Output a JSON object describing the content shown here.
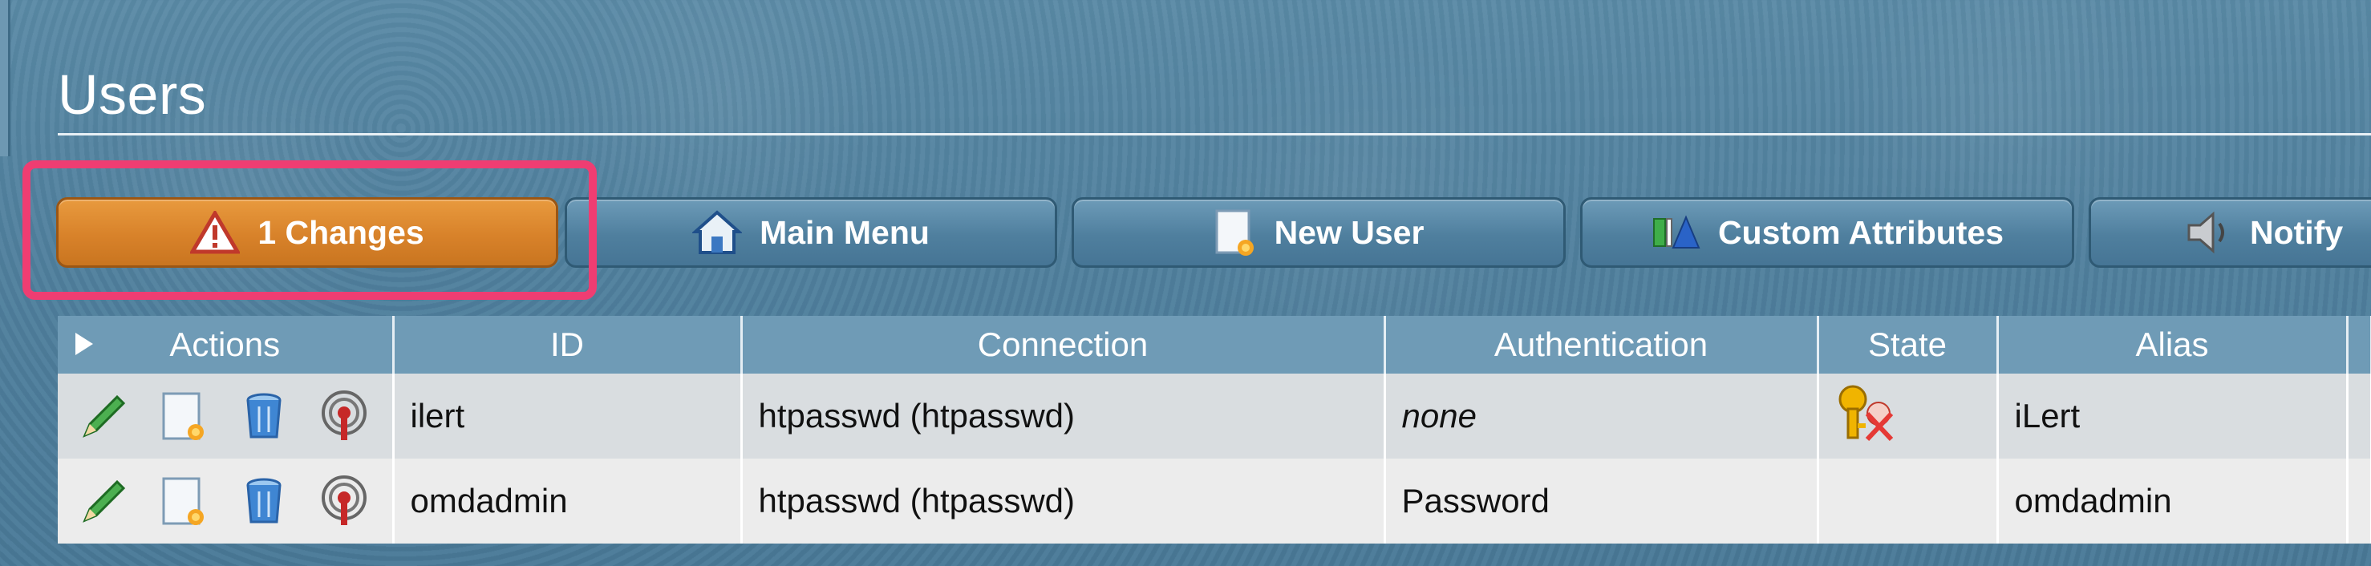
{
  "page": {
    "title": "Users"
  },
  "toolbar": {
    "changes_label": "1 Changes",
    "main_menu_label": "Main Menu",
    "new_user_label": "New User",
    "custom_attributes_label": "Custom Attributes",
    "notify_label": "Notify"
  },
  "table": {
    "headers": {
      "actions": "Actions",
      "id": "ID",
      "connection": "Connection",
      "authentication": "Authentication",
      "state": "State",
      "alias": "Alias"
    },
    "rows": [
      {
        "id": "ilert",
        "connection": "htpasswd (htpasswd)",
        "authentication": "none",
        "state_icon": "locked-key-icon",
        "alias": "iLert"
      },
      {
        "id": "omdadmin",
        "connection": "htpasswd (htpasswd)",
        "authentication": "Password",
        "state_icon": "",
        "alias": "omdadmin"
      }
    ]
  },
  "colors": {
    "changes_button": "#d8822a",
    "highlight": "#ef3d72",
    "header_bg": "#6f9bb6"
  }
}
